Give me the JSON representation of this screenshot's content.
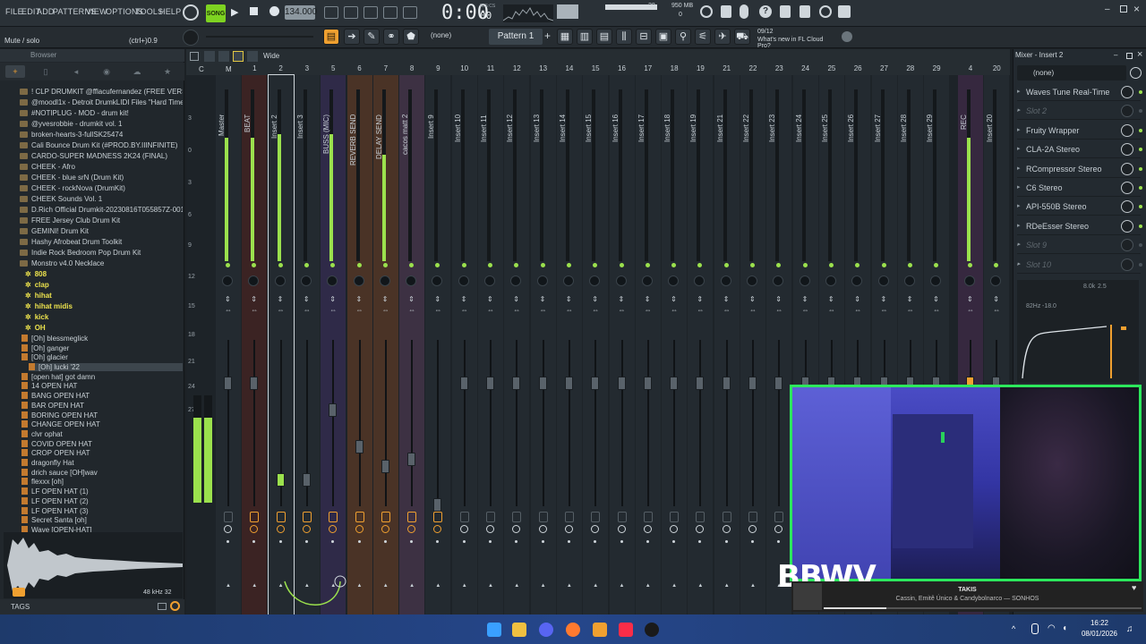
{
  "menu": [
    "FILE",
    "EDIT",
    "ADD",
    "PATTERNS",
    "VIEW",
    "OPTIONS",
    "TOOLS",
    "HELP"
  ],
  "transport": {
    "mode": "SONG",
    "tempo": "134.000",
    "time": "0:00",
    "time_sub": "00",
    "time_unit": "M:S:CS",
    "cpu": "28",
    "memory": "950 MB",
    "voices": "0"
  },
  "hint": {
    "text": "Mute / solo",
    "shortcut": "(ctrl+)0.9"
  },
  "toolbar2": {
    "snap": "(none)",
    "pattern": "Pattern 1",
    "news_date": "09/12",
    "news_text": "What's new in FL Cloud Pro?"
  },
  "mixer": {
    "title": "Mixer - Insert 2",
    "stereo_label": "Wide",
    "routing_letters": [
      "C",
      "M"
    ],
    "tracks": [
      {
        "num": "",
        "name": "Master",
        "color": "#232a30",
        "meter": 0.72,
        "fader": 0.78
      },
      {
        "num": "1",
        "name": "BEAT",
        "color": "#3b2323",
        "meter": 0.72,
        "fader": 0.78
      },
      {
        "num": "2",
        "name": "Insert 2",
        "color": "#232a30",
        "meter": 0.74,
        "fader": 0.2
      },
      {
        "num": "3",
        "name": "Insert 3",
        "color": "#232a30",
        "meter": 0,
        "fader": 0.2
      },
      {
        "num": "5",
        "name": "BUSS (MIC)",
        "color": "#2f2a48",
        "meter": 0.74,
        "fader": 0.62
      },
      {
        "num": "6",
        "name": "REVERB SEND",
        "color": "#4a3326",
        "meter": 0,
        "fader": 0.4
      },
      {
        "num": "7",
        "name": "DELAY SEND",
        "color": "#4a3326",
        "meter": 0.62,
        "fader": 0.28
      },
      {
        "num": "8",
        "name": "cacos matt 2",
        "color": "#3d3143",
        "meter": 0,
        "fader": 0.32
      },
      {
        "num": "9",
        "name": "Insert 9",
        "color": "#232a30",
        "meter": 0,
        "fader": 0.05
      },
      {
        "num": "10",
        "name": "Insert 10",
        "color": "#232a30",
        "meter": 0,
        "fader": 0.78
      },
      {
        "num": "11",
        "name": "Insert 11",
        "color": "#232a30",
        "meter": 0,
        "fader": 0.78
      },
      {
        "num": "12",
        "name": "Insert 12",
        "color": "#232a30",
        "meter": 0,
        "fader": 0.78
      },
      {
        "num": "13",
        "name": "Insert 13",
        "color": "#232a30",
        "meter": 0,
        "fader": 0.78
      },
      {
        "num": "14",
        "name": "Insert 14",
        "color": "#232a30",
        "meter": 0,
        "fader": 0.78
      },
      {
        "num": "15",
        "name": "Insert 15",
        "color": "#232a30",
        "meter": 0,
        "fader": 0.78
      },
      {
        "num": "16",
        "name": "Insert 16",
        "color": "#232a30",
        "meter": 0,
        "fader": 0.78
      },
      {
        "num": "17",
        "name": "Insert 17",
        "color": "#232a30",
        "meter": 0,
        "fader": 0.78
      },
      {
        "num": "18",
        "name": "Insert 18",
        "color": "#232a30",
        "meter": 0,
        "fader": 0.78
      },
      {
        "num": "19",
        "name": "Insert 19",
        "color": "#232a30",
        "meter": 0,
        "fader": 0.78
      },
      {
        "num": "21",
        "name": "Insert 21",
        "color": "#232a30",
        "meter": 0,
        "fader": 0.78
      },
      {
        "num": "22",
        "name": "Insert 22",
        "color": "#232a30",
        "meter": 0,
        "fader": 0.78
      },
      {
        "num": "23",
        "name": "Insert 23",
        "color": "#232a30",
        "meter": 0,
        "fader": 0.78
      },
      {
        "num": "24",
        "name": "Insert 24",
        "color": "#232a30",
        "meter": 0,
        "fader": 0.78
      },
      {
        "num": "25",
        "name": "Insert 25",
        "color": "#232a30",
        "meter": 0,
        "fader": 0.78
      },
      {
        "num": "26",
        "name": "Insert 26",
        "color": "#232a30",
        "meter": 0,
        "fader": 0.78
      },
      {
        "num": "27",
        "name": "Insert 27",
        "color": "#232a30",
        "meter": 0,
        "fader": 0.78
      },
      {
        "num": "28",
        "name": "Insert 28",
        "color": "#232a30",
        "meter": 0,
        "fader": 0.78
      },
      {
        "num": "29",
        "name": "Insert 29",
        "color": "#232a30",
        "meter": 0,
        "fader": 0.78
      },
      {
        "num": "4",
        "name": "REC",
        "color": "#36283f",
        "meter": 0.72,
        "fader": 0.78
      },
      {
        "num": "20",
        "name": "Insert 20",
        "color": "#232a30",
        "meter": 0,
        "fader": 0.78
      }
    ],
    "scale": [
      "3",
      "0",
      "3",
      "6",
      "9",
      "12",
      "15",
      "18",
      "21",
      "24",
      "27"
    ],
    "selected_preset": "(none)",
    "slots": [
      {
        "name": "Waves Tune Real-Time",
        "empty": false
      },
      {
        "name": "Slot 2",
        "empty": true
      },
      {
        "name": "Fruity Wrapper",
        "empty": false
      },
      {
        "name": "CLA-2A Stereo",
        "empty": false
      },
      {
        "name": "RCompressor Stereo",
        "empty": false
      },
      {
        "name": "C6 Stereo",
        "empty": false
      },
      {
        "name": "API-550B Stereo",
        "empty": false
      },
      {
        "name": "RDeEsser Stereo",
        "empty": false
      },
      {
        "name": "Slot 9",
        "empty": true
      },
      {
        "name": "Slot 10",
        "empty": true
      }
    ],
    "eq_labels": {
      "freq": "82Hz",
      "gain": "-18.0",
      "band": "8.0k",
      "band_val": "2.5"
    }
  },
  "browser": {
    "title": "Browser",
    "items": [
      {
        "label": "! CLP DRUMKIT @fflacufernandez (FREE VERSION)",
        "type": "folder"
      },
      {
        "label": "@moodl1x - Detroit DrumkLIDI Files \"Hard Times\"",
        "type": "folder"
      },
      {
        "label": "#NOTIPLUG - MOD - drum kit!",
        "type": "folder"
      },
      {
        "label": "@yvesrobbie - drumkit vol. 1",
        "type": "folder"
      },
      {
        "label": "broken-hearts-3-fullSK25474",
        "type": "folder"
      },
      {
        "label": "Cali Bounce Drum Kit (#PROD.BY.IIINFINITE)",
        "type": "folder"
      },
      {
        "label": "CARDO-SUPER MADNESS 2K24 (FINAL)",
        "type": "folder"
      },
      {
        "label": "CHEEK - Afro",
        "type": "folder"
      },
      {
        "label": "CHEEK - blue srN (Drum Kit)",
        "type": "folder"
      },
      {
        "label": "CHEEK - rockNova (DrumKit)",
        "type": "folder"
      },
      {
        "label": "CHEEK Sounds Vol. 1",
        "type": "folder"
      },
      {
        "label": "D.Rich Official Drumkit-20230816T055857Z-001",
        "type": "folder"
      },
      {
        "label": "FREE Jersey Club Drum Kit",
        "type": "folder"
      },
      {
        "label": "GEMINI! Drum Kit",
        "type": "folder"
      },
      {
        "label": "Hashy Afrobeat Drum Toolkit",
        "type": "folder"
      },
      {
        "label": "Indie Rock Bedroom Pop Drum Kit",
        "type": "folder"
      },
      {
        "label": "Monstro v4.0 Necklace",
        "type": "folder"
      },
      {
        "label": "808",
        "type": "star"
      },
      {
        "label": "clap",
        "type": "star"
      },
      {
        "label": "hihat",
        "type": "star"
      },
      {
        "label": "hihat midis",
        "type": "star"
      },
      {
        "label": "kick",
        "type": "star"
      },
      {
        "label": "OH",
        "type": "star"
      },
      {
        "label": "[Oh] blessmeglick",
        "type": "file"
      },
      {
        "label": "[Oh] ganger",
        "type": "file"
      },
      {
        "label": "[Oh] glacier",
        "type": "file"
      },
      {
        "label": "[Oh] lucki '22",
        "type": "file"
      },
      {
        "label": "[open hat] got damn",
        "type": "file"
      },
      {
        "label": "14 OPEN HAT",
        "type": "file"
      },
      {
        "label": "BANG OPEN HAT",
        "type": "file"
      },
      {
        "label": "BAR OPEN HAT",
        "type": "file"
      },
      {
        "label": "BORING OPEN HAT",
        "type": "file"
      },
      {
        "label": "CHANGE OPEN HAT",
        "type": "file"
      },
      {
        "label": "clvr ophat",
        "type": "file"
      },
      {
        "label": "COVID OPEN HAT",
        "type": "file"
      },
      {
        "label": "CROP OPEN HAT",
        "type": "file"
      },
      {
        "label": "dragonfly Hat",
        "type": "file"
      },
      {
        "label": "drich sauce [OH]wav",
        "type": "file"
      },
      {
        "label": "flexxx [oh]",
        "type": "file"
      },
      {
        "label": "LF OPEN HAT (1)",
        "type": "file"
      },
      {
        "label": "LF OPEN HAT (2)",
        "type": "file"
      },
      {
        "label": "LF OPEN HAT (3)",
        "type": "file"
      },
      {
        "label": "Secret Santa [oh]",
        "type": "file"
      },
      {
        "label": "Wave [OPEN-HAT]",
        "type": "file"
      }
    ],
    "sample_info": "48 kHz 32",
    "tags_label": "TAGS"
  },
  "overlay": {
    "logo": "BBWV",
    "np_title": "TAKIS",
    "np_artist": "Cassin, Emitê Único & Candybolnarco — SONHOS"
  },
  "taskbar": {
    "time": "16:22",
    "date": "08/01/2026"
  },
  "colors": {
    "accent_green": "#9be14d",
    "accent_orange": "#f0a030",
    "webcam_border": "#2ce85c"
  }
}
